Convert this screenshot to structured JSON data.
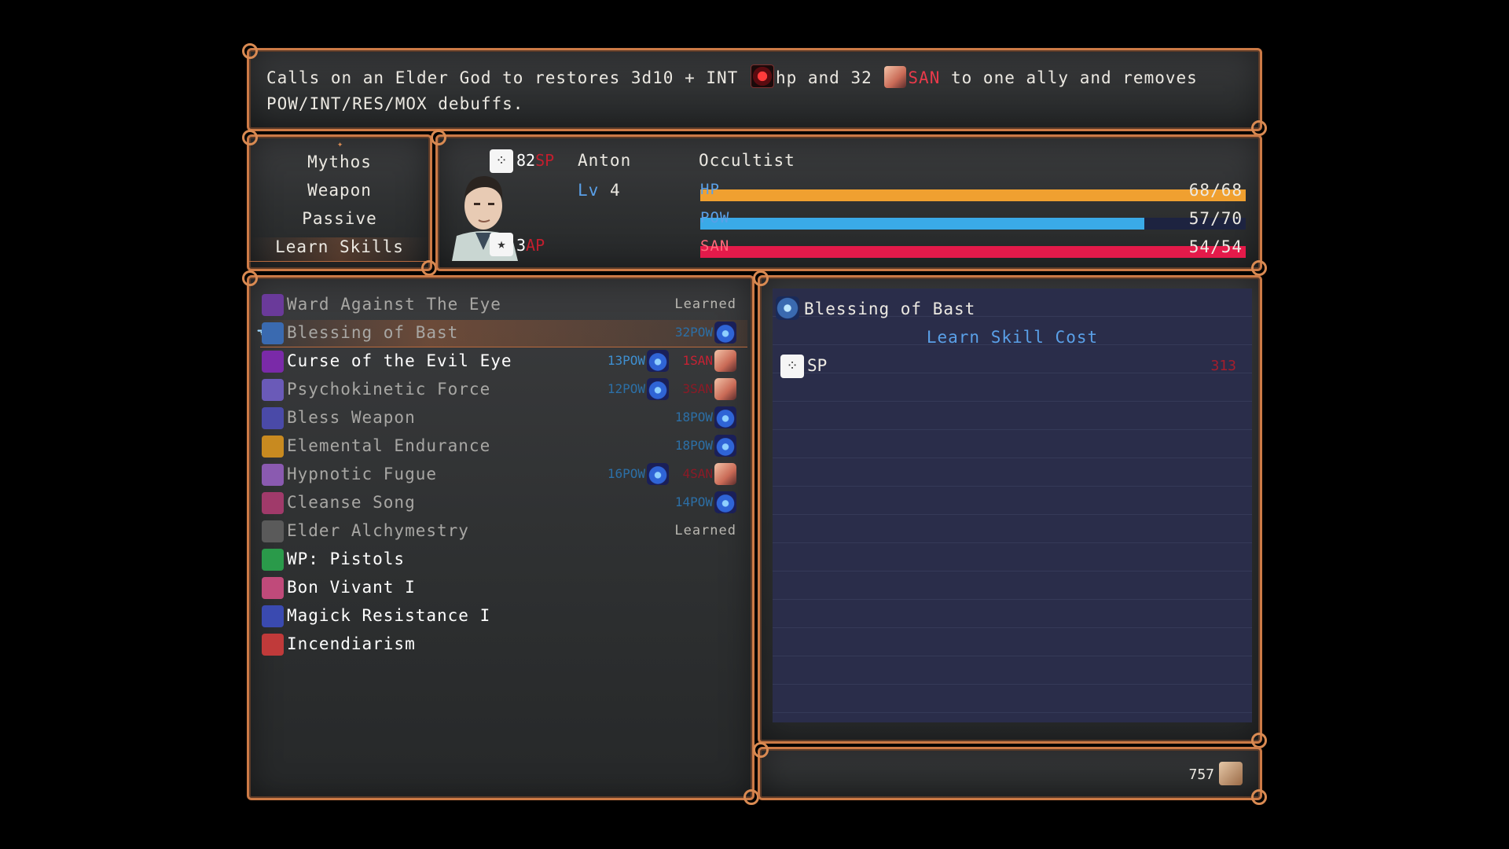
{
  "description": {
    "part1": "Calls on an Elder God to restores 3d10 + INT",
    "hp_word": "hp and 32",
    "san_word": "SAN",
    "part2": "to one ally and removes",
    "line2": "POW/INT/RES/MOX debuffs."
  },
  "menu": {
    "items": [
      "Mythos",
      "Weapon",
      "Passive",
      "Learn Skills"
    ],
    "selected": "Learn Skills"
  },
  "character": {
    "sp_value": "82",
    "sp_unit": "SP",
    "ap_value": "3",
    "ap_unit": "AP",
    "name": "Anton",
    "level_label": "Lv",
    "level": "4",
    "class": "Occultist",
    "bars": [
      {
        "name": "HP",
        "value": "68/68",
        "fraction": 1.0,
        "color": "#f0a030"
      },
      {
        "name": "POW",
        "value": "57/70",
        "fraction": 0.814,
        "color": "#3aaae8"
      },
      {
        "name": "SAN",
        "value": "54/54",
        "fraction": 1.0,
        "color": "#e41a4a"
      }
    ]
  },
  "skills": [
    {
      "name": "Ward Against The Eye",
      "status": "Learned",
      "icon": "eye-ward-icon",
      "color": "#6a3a9a"
    },
    {
      "name": "Blessing of Bast",
      "pow": "32POW",
      "icon": "bast-icon",
      "color": "#3a6ab0"
    },
    {
      "name": "Curse of the Evil Eye",
      "pow": "13POW",
      "san": "1SAN",
      "icon": "evil-eye-icon",
      "color": "#7a2aa8"
    },
    {
      "name": "Psychokinetic Force",
      "pow": "12POW",
      "san": "3SAN",
      "icon": "psychokinesis-icon",
      "color": "#6a5ab8"
    },
    {
      "name": "Bless Weapon",
      "pow": "18POW",
      "icon": "bless-weapon-icon",
      "color": "#4a4aa8"
    },
    {
      "name": "Elemental Endurance",
      "pow": "18POW",
      "icon": "elemental-icon",
      "color": "#c88a20"
    },
    {
      "name": "Hypnotic Fugue",
      "pow": "16POW",
      "san": "4SAN",
      "icon": "hypnotic-icon",
      "color": "#8a5ab0"
    },
    {
      "name": "Cleanse Song",
      "pow": "14POW",
      "icon": "cleanse-song-icon",
      "color": "#a03a6a"
    },
    {
      "name": "Elder Alchymestry",
      "status": "Learned",
      "icon": "alchemy-icon",
      "color": "#5a5a5a"
    },
    {
      "name": "WP: Pistols",
      "icon": "pistol-icon",
      "color": "#2a9a4a"
    },
    {
      "name": "Bon Vivant I",
      "icon": "bon-vivant-icon",
      "color": "#c04a7a"
    },
    {
      "name": "Magick Resistance I",
      "icon": "magick-resistance-icon",
      "color": "#3a4ab0"
    },
    {
      "name": "Incendiarism",
      "icon": "incendiarism-icon",
      "color": "#c03a3a"
    }
  ],
  "detail": {
    "title": "Blessing of Bast",
    "subtitle": "Learn Skill Cost",
    "cost_label": "SP",
    "cost_value": "313"
  },
  "gold": {
    "value": "757"
  }
}
